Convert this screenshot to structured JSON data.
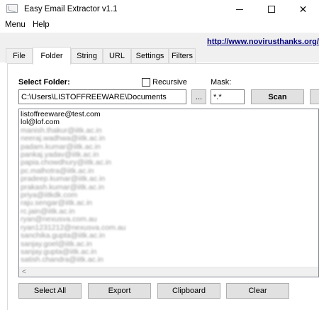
{
  "window": {
    "title": "Easy Email Extractor v1.1",
    "minimize_glyph": "",
    "maximize_glyph": "",
    "close_glyph": "✕"
  },
  "menu": {
    "items": [
      "Menu",
      "Help"
    ]
  },
  "header": {
    "link": "http://www.novirusthanks.org/"
  },
  "tabs": [
    {
      "label": "File"
    },
    {
      "label": "Folder",
      "active": true
    },
    {
      "label": "String"
    },
    {
      "label": "URL"
    },
    {
      "label": "Settings"
    },
    {
      "label": "Filters"
    }
  ],
  "folder": {
    "label": "Select Folder:",
    "path": "C:\\Users\\LISTOFFREEWARE\\Documents",
    "browse_label": "..."
  },
  "recursive": {
    "label": "Recursive",
    "checked": false
  },
  "mask": {
    "label": "Mask:",
    "value": "*.*"
  },
  "scan": {
    "label": "Scan"
  },
  "results": {
    "emails": [
      "listoffreeware@test.com",
      "lol@lof.com",
      "manish.thakur@iitk.ac.in",
      "neeraj.wadhwa@iitk.ac.in",
      "padam.kumar@iitk.ac.in",
      "pankaj.yadav@iitk.ac.in",
      "papia.chowdhury@iitk.ac.in",
      "pc.malhotra@iitk.ac.in",
      "pradeep.kumar@iitk.ac.in",
      "prakash.kumar@iitk.ac.in",
      "priya@iitkdk.com",
      "raju.sengar@iitk.ac.in",
      "rc.jain@iitk.ac.in",
      "ryan@nexusva.com.au",
      "ryan1231212@nexusva.com.au",
      "sanchika.gupta@iitk.ac.in",
      "sanjay.goel@iitk.ac.in",
      "sanjay.gupta@iitk.ac.in",
      "satish.chandra@iitk.ac.in"
    ],
    "scroll_left_glyph": "<"
  },
  "actions": {
    "select_all": "Select All",
    "export": "Export",
    "clipboard": "Clipboard",
    "clear": "Clear"
  }
}
